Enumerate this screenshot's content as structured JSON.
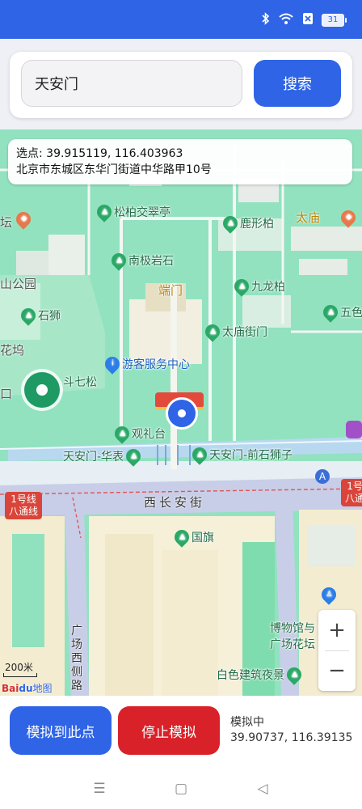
{
  "status_bar": {
    "icons": [
      "bluetooth-icon",
      "wifi-icon",
      "sim-icon",
      "battery-icon"
    ],
    "battery": "31"
  },
  "search": {
    "value": "天安门",
    "button_label": "搜索"
  },
  "selection": {
    "coords_text": "选点: 39.915119, 116.403963",
    "address": "北京市东城区东华门街道中华路甲10号"
  },
  "map": {
    "pois": [
      {
        "label": "松柏交翠亭"
      },
      {
        "label": "鹿形柏"
      },
      {
        "label": "南极岩石"
      },
      {
        "label": "九龙柏"
      },
      {
        "label": "石狮"
      },
      {
        "label": "太庙街门"
      },
      {
        "label": "游客服务中心"
      },
      {
        "label": "斗七松"
      },
      {
        "label": "观礼台"
      },
      {
        "label": "天安门-华表"
      },
      {
        "label": "天安门-前石狮子"
      },
      {
        "label": "国旗"
      },
      {
        "label": "博物馆与"
      },
      {
        "label": "广场花坛"
      },
      {
        "label": "白色建筑夜景"
      },
      {
        "label": "五色"
      }
    ],
    "area_labels": {
      "taimiao": "太庙",
      "duanmen": "端门",
      "park": "山公园",
      "huawu": "花坞",
      "tan": "坛",
      "kou": "口"
    },
    "street": "西长安街",
    "side_street": "广场西侧路",
    "metro_left": "1号线\n八通线",
    "metro_right": "1号\n八通",
    "exit_label": "A",
    "scale": "200米",
    "logo_text": "Bai",
    "logo_du": "du",
    "logo_map": "地图",
    "zoom_in": "+",
    "zoom_out": "−"
  },
  "bottom": {
    "simulate_label": "模拟到此点",
    "stop_label": "停止模拟",
    "status_label": "模拟中",
    "status_coords": "39.90737, 116.39135"
  },
  "nav": {
    "menu": "☰",
    "home": "▢",
    "back": "◁"
  }
}
